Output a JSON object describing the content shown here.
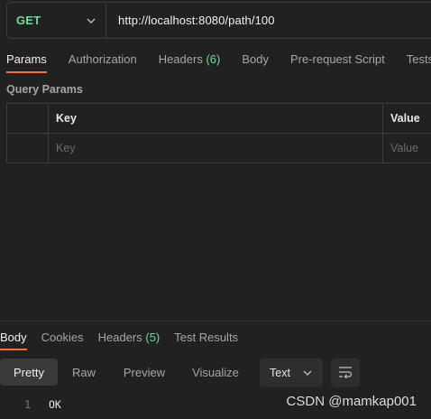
{
  "request": {
    "method": "GET",
    "url": "http://localhost:8080/path/100"
  },
  "request_tabs": [
    {
      "label": "Params",
      "active": true
    },
    {
      "label": "Authorization"
    },
    {
      "label": "Headers ",
      "count": "(6)"
    },
    {
      "label": "Body"
    },
    {
      "label": "Pre-request Script"
    },
    {
      "label": "Tests"
    }
  ],
  "query_params": {
    "title": "Query Params",
    "columns": {
      "key": "Key",
      "value": "Value"
    },
    "placeholders": {
      "key": "Key",
      "value": "Value"
    }
  },
  "response_tabs": [
    {
      "label": "Body",
      "active": true
    },
    {
      "label": "Cookies"
    },
    {
      "label": "Headers ",
      "count": "(5)"
    },
    {
      "label": "Test Results"
    }
  ],
  "view_modes": [
    "Pretty",
    "Raw",
    "Preview",
    "Visualize"
  ],
  "active_view_mode": "Pretty",
  "format": "Text",
  "response_body": [
    {
      "line": "1",
      "text": "OK"
    }
  ],
  "watermark": "CSDN @mamkap001",
  "colors": {
    "method": "#6bdd9a",
    "accent": "#ff6c37",
    "count": "#6bdd9a",
    "background": "#212121"
  },
  "icons": {
    "method_dropdown": "chevron-down-icon",
    "format_dropdown": "chevron-down-icon",
    "wrap": "wrap-lines-icon"
  }
}
